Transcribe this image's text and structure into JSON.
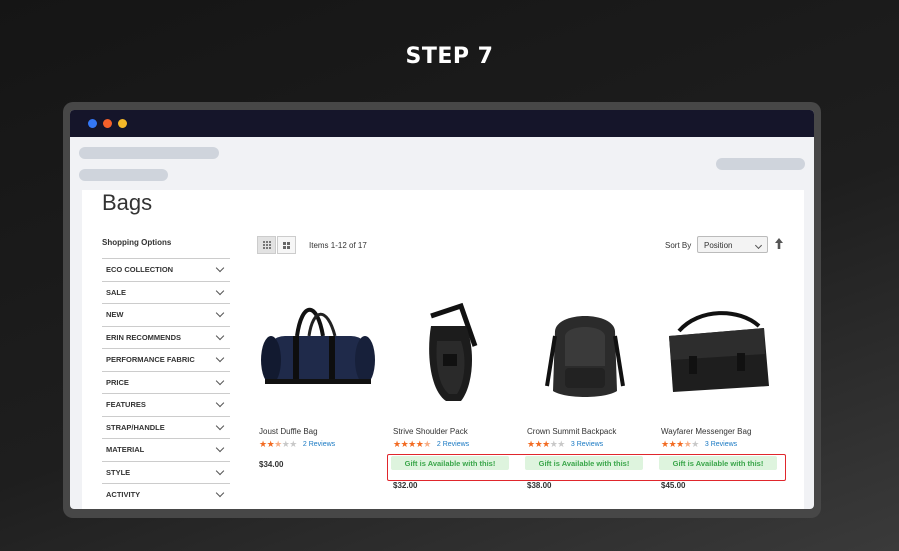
{
  "step_label": "STEP 7",
  "page": {
    "title": "Bags",
    "shopping_options_label": "Shopping Options",
    "filters": [
      "ECO COLLECTION",
      "SALE",
      "NEW",
      "ERIN RECOMMENDS",
      "PERFORMANCE FABRIC",
      "PRICE",
      "FEATURES",
      "STRAP/HANDLE",
      "MATERIAL",
      "STYLE",
      "ACTIVITY"
    ],
    "toolbar": {
      "items_count": "Items 1-12 of 17",
      "sort_label": "Sort By",
      "sort_value": "Position"
    },
    "products": [
      {
        "name": "Joust Duffle Bag",
        "rating": 2.5,
        "reviews": "2  Reviews",
        "price": "$34.00",
        "gift": ""
      },
      {
        "name": "Strive Shoulder Pack",
        "rating": 4.5,
        "reviews": "2  Reviews",
        "price": "$32.00",
        "gift": "Gift is Available with this!"
      },
      {
        "name": "Crown Summit Backpack",
        "rating": 3,
        "reviews": "3  Reviews",
        "price": "$38.00",
        "gift": "Gift is Available with this!"
      },
      {
        "name": "Wayfarer Messenger Bag",
        "rating": 3.5,
        "reviews": "3  Reviews",
        "price": "$45.00",
        "gift": "Gift is Available with this!"
      }
    ]
  },
  "colors": {
    "titlebar": "#15152a",
    "star_on": "#f26b22",
    "review_link": "#1979c3",
    "gift_bg": "#def4de",
    "gift_text": "#3aa64a",
    "highlight": "#e0262c"
  },
  "icons": [
    "grid-view-icon",
    "list-view-icon",
    "chevron-down-icon",
    "sort-arrow-up-icon"
  ]
}
